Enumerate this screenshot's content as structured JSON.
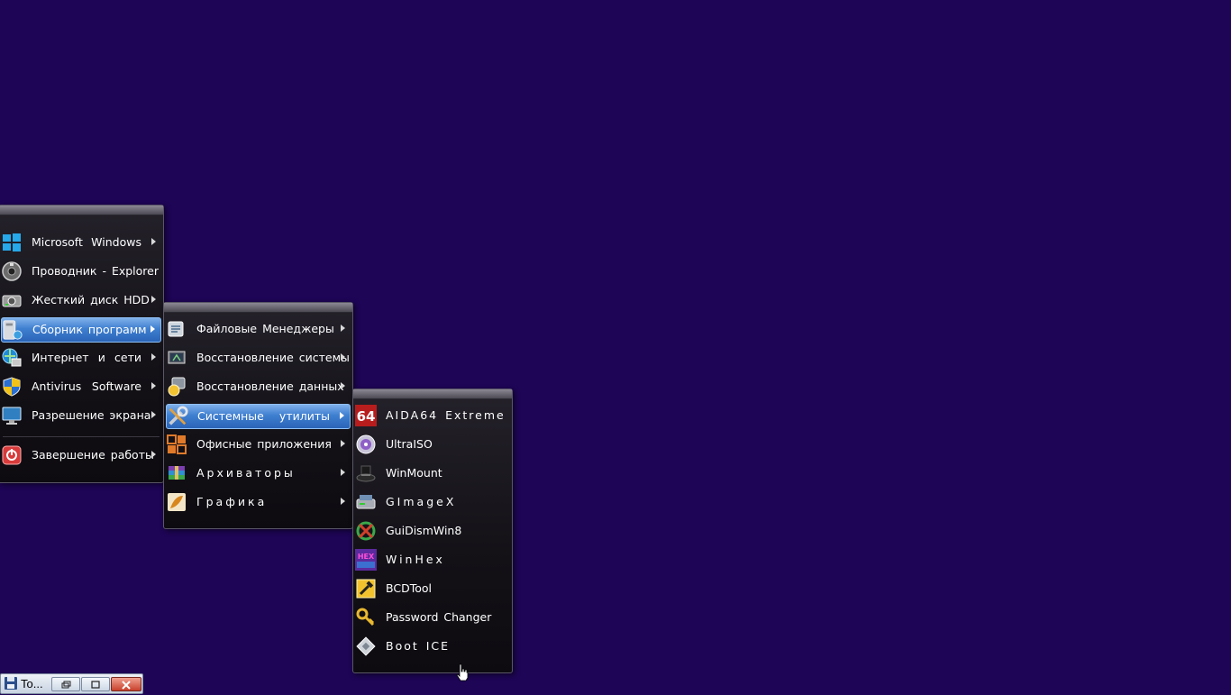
{
  "menu_main": {
    "items": [
      {
        "label": "Microsoft  Windows",
        "icon": "windows-logo-icon",
        "submenu": true
      },
      {
        "label": "Проводник - Explorer",
        "icon": "disc-drive-icon",
        "submenu": false
      },
      {
        "label": "Жесткий диск HDD",
        "icon": "hard-drive-icon",
        "submenu": true
      },
      {
        "label": "Сборник  программ",
        "icon": "programs-folder-icon",
        "submenu": true,
        "selected": true
      },
      {
        "label": "Интернет   и   сети",
        "icon": "globe-network-icon",
        "submenu": true
      },
      {
        "label": "Antivirus   Software",
        "icon": "shield-icon",
        "submenu": true
      },
      {
        "label": "Разрешение экрана",
        "icon": "monitor-icon",
        "submenu": true
      },
      {
        "label": "Завершение работы",
        "icon": "power-icon",
        "submenu": true
      }
    ]
  },
  "menu_programs": {
    "items": [
      {
        "label": "Файловые  Менеджеры",
        "icon": "file-manager-icon"
      },
      {
        "label": "Восстановление системы",
        "icon": "system-restore-icon"
      },
      {
        "label": "Восстановление данных",
        "icon": "data-recovery-icon"
      },
      {
        "label": "Системные   утилиты",
        "icon": "tools-icon",
        "selected": true
      },
      {
        "label": "Офисные  приложения",
        "icon": "office-icon"
      },
      {
        "label": "Архиваторы",
        "icon": "archive-icon"
      },
      {
        "label": "Графика",
        "icon": "graphics-icon"
      }
    ]
  },
  "menu_utils": {
    "items": [
      {
        "label": "AIDA64 Extreme",
        "icon": "aida64-icon"
      },
      {
        "label": "UltraISO",
        "icon": "ultraiso-disc-icon"
      },
      {
        "label": "WinMount",
        "icon": "winmount-hat-icon"
      },
      {
        "label": "GImageX",
        "icon": "gimagex-drive-icon"
      },
      {
        "label": "GuiDismWin8",
        "icon": "guidism-icon"
      },
      {
        "label": "WinHex",
        "icon": "winhex-icon"
      },
      {
        "label": "BCDTool",
        "icon": "bcdtool-icon"
      },
      {
        "label": "Password Changer",
        "icon": "key-icon"
      },
      {
        "label": "Boot ICE",
        "icon": "bootice-icon"
      }
    ]
  },
  "taskbar": {
    "button_label": "To...",
    "icon": "floppy-save-icon"
  },
  "colors": {
    "desktop": "#1e0556",
    "selection": "#3f7fd0",
    "menu_bg": "#131116"
  }
}
